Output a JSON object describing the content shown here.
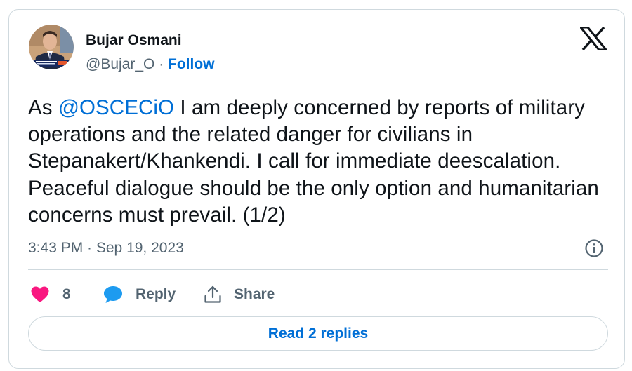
{
  "author": {
    "name": "Bujar Osmani",
    "handle": "@Bujar_O",
    "separator": " · ",
    "follow_label": "Follow",
    "avatar_icon": "profile-photo-avatar"
  },
  "tweet": {
    "text_prefix": "As ",
    "mention": "@OSCECiO",
    "text_body": " I am deeply concerned by reports of military operations and the related danger for civilians in Stepanakert/Khankendi. I call for immediate deescalation. Peaceful dialogue should be the only option and humanitarian concerns must prevail. (1/2)",
    "timestamp": "3:43 PM · Sep 19, 2023"
  },
  "actions": {
    "like_count": "8",
    "reply_label": "Reply",
    "share_label": "Share"
  },
  "footer": {
    "read_replies_label": "Read 2 replies"
  },
  "icons": {
    "brand": "x-logo-icon",
    "info": "info-icon",
    "like": "heart-icon",
    "reply": "speech-bubble-icon",
    "share": "share-upload-icon"
  },
  "colors": {
    "accent": "#006fd6",
    "like": "#f91880",
    "reply": "#1d9bf0",
    "muted": "#536471",
    "border": "#cfd9de"
  }
}
